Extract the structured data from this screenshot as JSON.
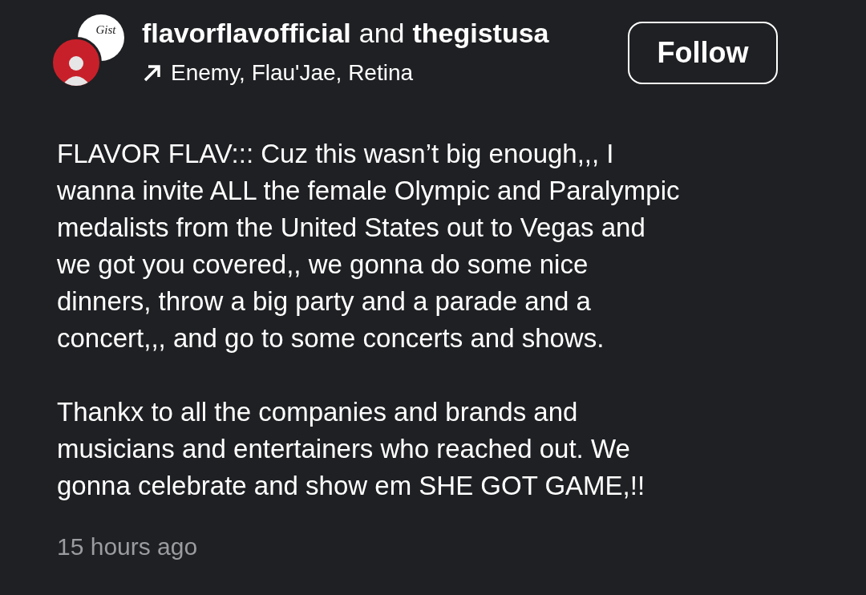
{
  "post_header": {
    "logo_text": "Gist",
    "authors": [
      {
        "name": "flavorflavofficial"
      },
      {
        "name": "thegistusa"
      }
    ],
    "joiner": "and",
    "subtitle": "Enemy, Flau'Jae, Retina",
    "follow_button": "Follow"
  },
  "caption": {
    "paragraphs": [
      [
        "FLAVOR FLAV::: Cuz this wasn’t big enough,,, I",
        "wanna invite ALL the female Olympic and Paralympic",
        "medalists from the United States out to Vegas and",
        "we got you covered,, we gonna do some nice",
        "dinners, throw a big party and a parade and a",
        "concert,,, and go to some concerts and shows."
      ],
      [
        "Thankx to all the companies and brands and",
        "musicians and entertainers who reached out. We",
        "gonna celebrate and show em SHE GOT GAME,!!"
      ]
    ]
  },
  "timestamp": "15 hours ago"
}
